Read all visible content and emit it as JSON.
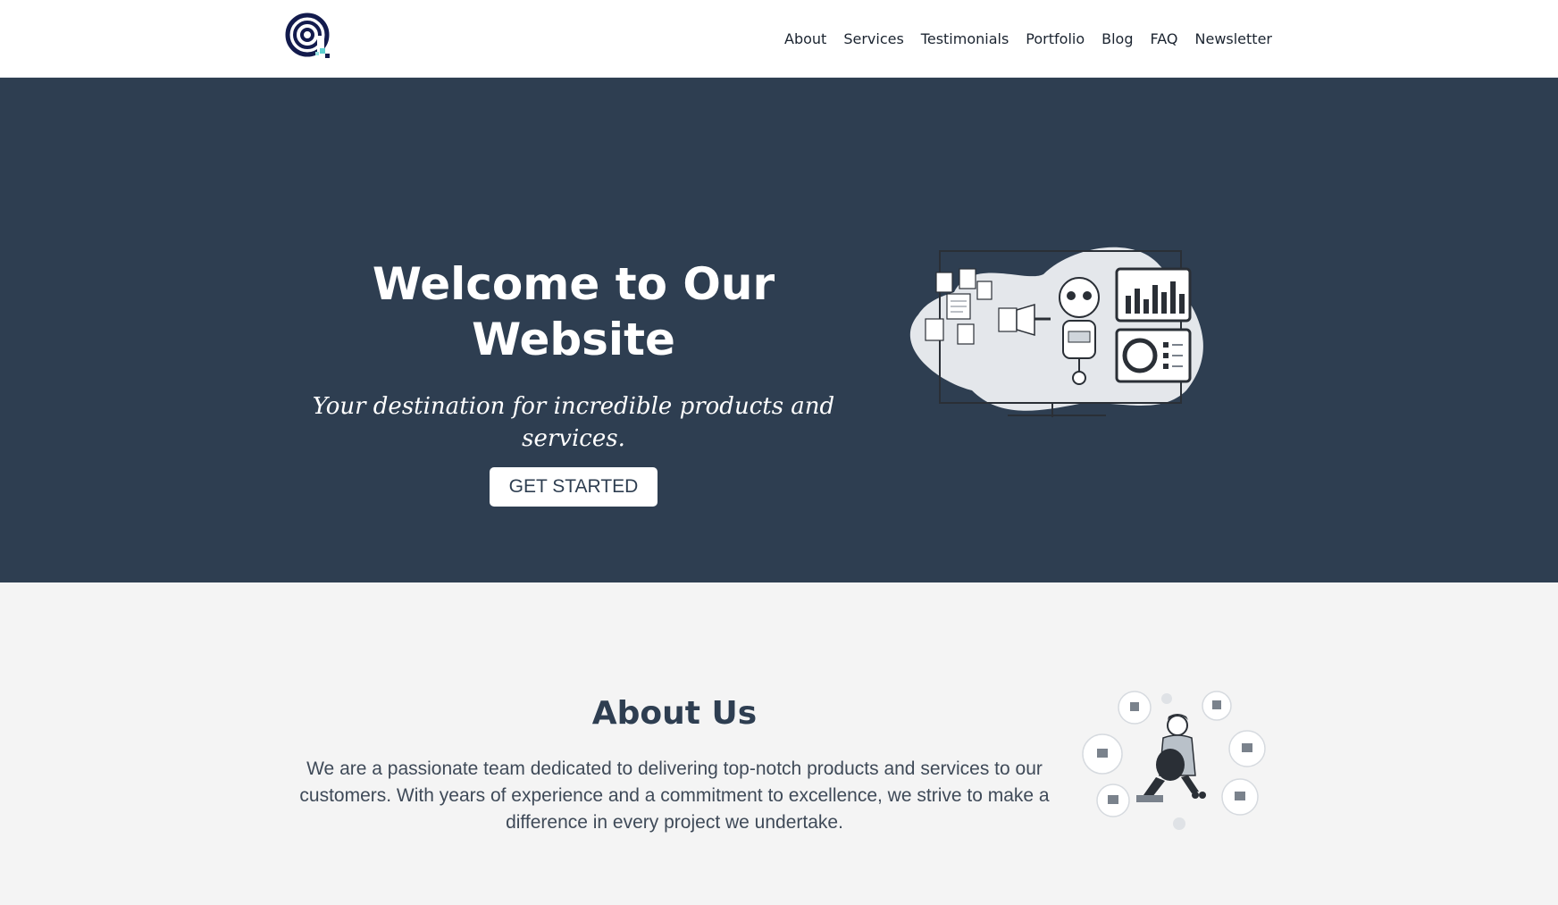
{
  "header": {
    "logo_name": "at-sign-logo",
    "nav": [
      {
        "label": "About"
      },
      {
        "label": "Services"
      },
      {
        "label": "Testimonials"
      },
      {
        "label": "Portfolio"
      },
      {
        "label": "Blog"
      },
      {
        "label": "FAQ"
      },
      {
        "label": "Newsletter"
      }
    ]
  },
  "hero": {
    "title": "Welcome to Our Website",
    "subtitle": "Your destination for incredible products and services.",
    "cta_label": "GET STARTED",
    "illustration_name": "data-robot-illustration"
  },
  "about": {
    "title": "About Us",
    "body": "We are a passionate team dedicated to delivering top-notch products and services to our customers. With years of experience and a commitment to excellence, we strive to make a difference in every project we undertake.",
    "illustration_name": "person-hobbies-illustration"
  },
  "colors": {
    "hero_bg": "#2e3e51",
    "header_bg": "#ffffff",
    "page_bg": "#f4f4f4",
    "text_dark": "#2e3e51",
    "logo_navy": "#131b4d",
    "logo_accent": "#5fd0d0"
  }
}
